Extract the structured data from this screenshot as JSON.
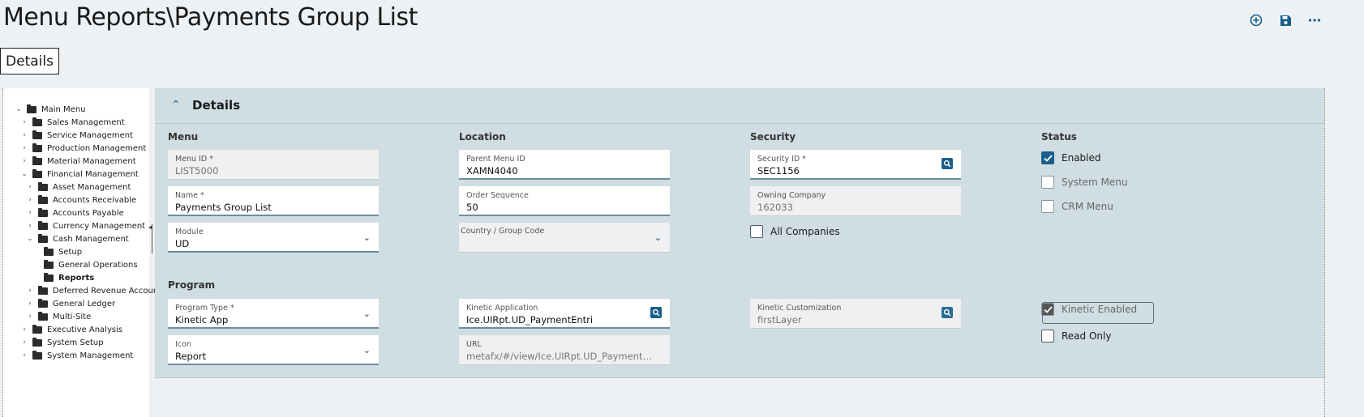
{
  "page": {
    "title": "Menu Reports\\Payments Group List"
  },
  "top_actions": {
    "add_icon": "plus-circle",
    "save_icon": "floppy-disk",
    "more_icon": "ellipsis"
  },
  "tab": {
    "label": "Details"
  },
  "tree": {
    "items": [
      {
        "label": "Main Menu",
        "chev": "⌄",
        "level": 0
      },
      {
        "label": "Sales Management",
        "chev": "›",
        "level": 1
      },
      {
        "label": "Service Management",
        "chev": "›",
        "level": 1
      },
      {
        "label": "Production Management",
        "chev": "›",
        "level": 1
      },
      {
        "label": "Material Management",
        "chev": "›",
        "level": 1
      },
      {
        "label": "Financial Management",
        "chev": "⌄",
        "level": 1
      },
      {
        "label": "Asset Management",
        "chev": "›",
        "level": 2
      },
      {
        "label": "Accounts Receivable",
        "chev": "›",
        "level": 2
      },
      {
        "label": "Accounts Payable",
        "chev": "›",
        "level": 2
      },
      {
        "label": "Currency Management",
        "chev": "›",
        "level": 2
      },
      {
        "label": "Cash Management",
        "chev": "⌄",
        "level": 2
      },
      {
        "label": "Setup",
        "chev": "",
        "level": 3
      },
      {
        "label": "General Operations",
        "chev": "",
        "level": 3
      },
      {
        "label": "Reports",
        "chev": "",
        "level": 3,
        "selected": true
      },
      {
        "label": "Deferred Revenue Accoun",
        "chev": "›",
        "level": 2
      },
      {
        "label": "General Ledger",
        "chev": "›",
        "level": 2
      },
      {
        "label": "Multi-Site",
        "chev": "›",
        "level": 2
      },
      {
        "label": "Executive Analysis",
        "chev": "›",
        "level": 1
      },
      {
        "label": "System Setup",
        "chev": "›",
        "level": 1
      },
      {
        "label": "System Management",
        "chev": "›",
        "level": 1
      }
    ]
  },
  "panel": {
    "title": "Details",
    "sections": {
      "menu": "Menu",
      "location": "Location",
      "security": "Security",
      "status": "Status",
      "program": "Program"
    },
    "fields": {
      "menu_id": {
        "label": "Menu ID *",
        "value": "LIST5000"
      },
      "name": {
        "label": "Name *",
        "value": "Payments Group List"
      },
      "module": {
        "label": "Module",
        "value": "UD"
      },
      "parent_menu_id": {
        "label": "Parent Menu ID",
        "value": "XAMN4040"
      },
      "order_sequence": {
        "label": "Order Sequence",
        "value": "50"
      },
      "country_group_code": {
        "label": "Country / Group Code",
        "value": ""
      },
      "security_id": {
        "label": "Security ID *",
        "value": "SEC1156"
      },
      "owning_company": {
        "label": "Owning Company",
        "value": "162033"
      },
      "program_type": {
        "label": "Program Type *",
        "value": "Kinetic App"
      },
      "icon": {
        "label": "Icon",
        "value": "Report"
      },
      "kinetic_application": {
        "label": "Kinetic Application",
        "value": "Ice.UIRpt.UD_PaymentEntri"
      },
      "url": {
        "label": "URL",
        "value": "metafx/#/view/Ice.UIRpt.UD_PaymentEntri..."
      },
      "kinetic_customization": {
        "label": "Kinetic Customization",
        "value": "firstLayer"
      }
    },
    "checkboxes": {
      "all_companies": {
        "label": "All Companies",
        "checked": false
      },
      "enabled": {
        "label": "Enabled",
        "checked": true
      },
      "system_menu": {
        "label": "System Menu",
        "checked": false
      },
      "crm_menu": {
        "label": "CRM Menu",
        "checked": false
      },
      "kinetic_enabled": {
        "label": "Kinetic Enabled",
        "checked": true
      },
      "read_only": {
        "label": "Read Only",
        "checked": false
      }
    }
  },
  "colors": {
    "accent": "#1b5f8a",
    "panel_bg": "#d0dde2",
    "page_bg": "#edf1f4"
  }
}
